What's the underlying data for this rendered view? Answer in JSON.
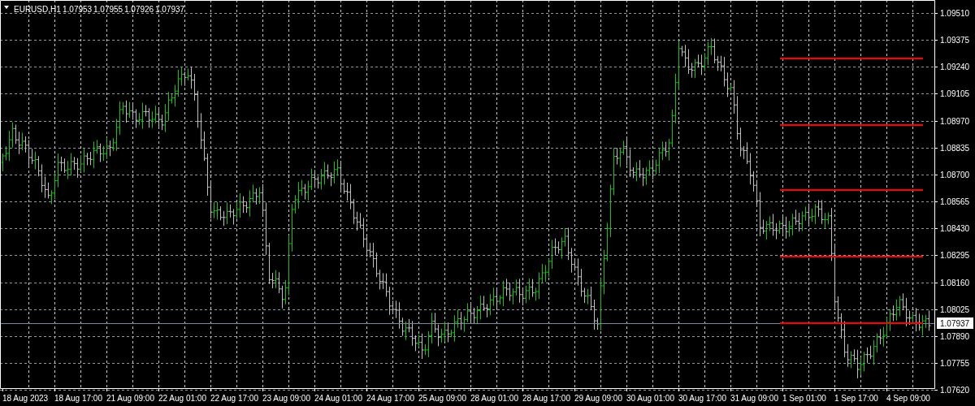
{
  "chart_header": {
    "symbol": "EURUSD,H1",
    "ohlc": [
      "1.07953",
      "1.07955",
      "1.07926",
      "1.07937"
    ]
  },
  "price_axis": {
    "labels": [
      "1.09510",
      "1.09375",
      "1.09240",
      "1.09105",
      "1.08970",
      "1.08835",
      "1.08700",
      "1.08565",
      "1.08430",
      "1.08295",
      "1.08160",
      "1.08025",
      "1.07890",
      "1.07755",
      "1.07620"
    ],
    "current_price": "1.07937"
  },
  "time_axis": {
    "labels": [
      "18 Aug 2023",
      "18 Aug 17:00",
      "21 Aug 09:00",
      "22 Aug 01:00",
      "22 Aug 17:00",
      "23 Aug 09:00",
      "24 Aug 01:00",
      "24 Aug 17:00",
      "25 Aug 09:00",
      "28 Aug 01:00",
      "28 Aug 17:00",
      "29 Aug 09:00",
      "30 Aug 01:00",
      "30 Aug 17:00",
      "31 Aug 09:00",
      "1 Sep 01:00",
      "1 Sep 17:00",
      "4 Sep 09:00"
    ]
  }
}
